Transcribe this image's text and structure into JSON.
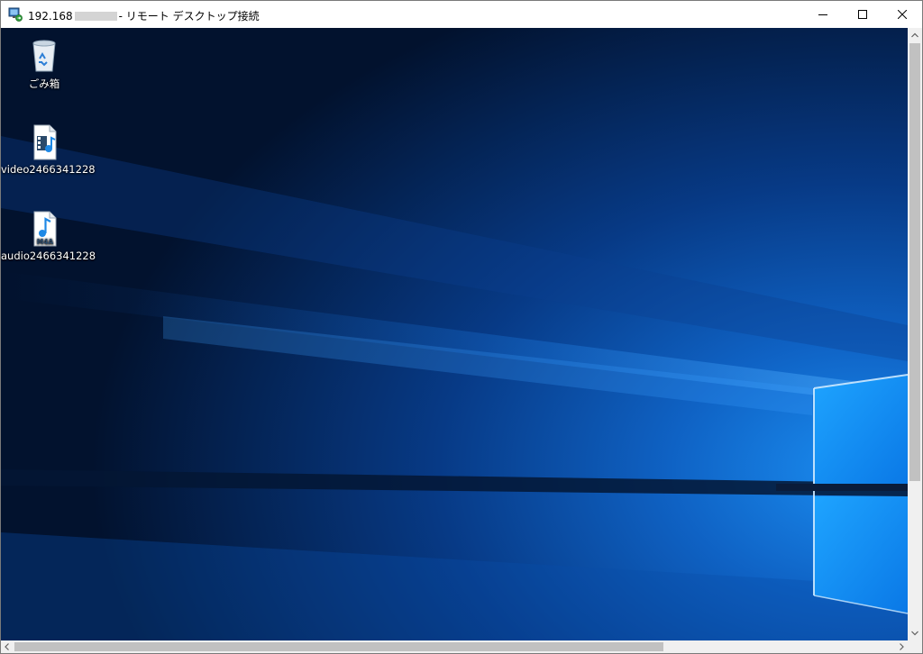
{
  "window": {
    "title_prefix": "192.168",
    "title_suffix": "- リモート デスクトップ接続",
    "controls": [
      "minimize-icon",
      "maximize-icon",
      "close-icon"
    ]
  },
  "desktop": {
    "icons": [
      {
        "label": "ごみ箱",
        "icon": "recycle-bin-icon"
      },
      {
        "label": "video2466341228",
        "icon": "video-file-icon"
      },
      {
        "label": "audio2466341228",
        "icon": "m4a-audio-file-icon",
        "badge": "M4A"
      }
    ]
  },
  "colors": {
    "accent": "#0a7fe0",
    "background_dark": "#031a3c"
  }
}
